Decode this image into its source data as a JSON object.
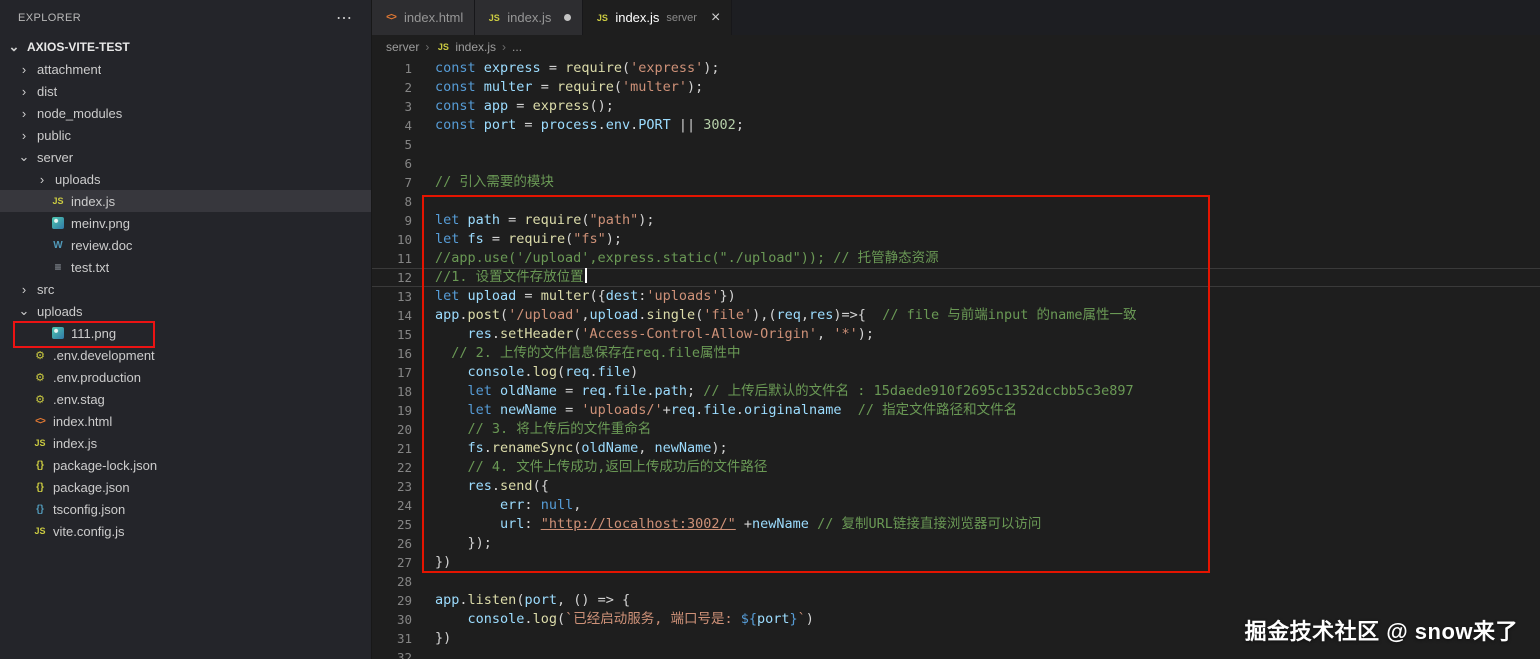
{
  "ui": {
    "dots": "⋯",
    "chev_open": "⌄",
    "chev_closed": "›",
    "crumb_sep": "›",
    "close": "×"
  },
  "icon_glyphs": {
    "js": "JS",
    "html": "<>",
    "json": "{}",
    "jsonblue": "{}",
    "env": "⚙",
    "doc": "W",
    "txt": "≡",
    "img": ""
  },
  "explorer": {
    "title": "EXPLORER",
    "root": "AXIOS-VITE-TEST",
    "items": [
      {
        "label": "attachment",
        "kind": "folder",
        "depth": 1
      },
      {
        "label": "dist",
        "kind": "folder",
        "depth": 1
      },
      {
        "label": "node_modules",
        "kind": "folder",
        "depth": 1
      },
      {
        "label": "public",
        "kind": "folder",
        "depth": 1
      },
      {
        "label": "server",
        "kind": "folder",
        "depth": 1,
        "expanded": true
      },
      {
        "label": "uploads",
        "kind": "folder",
        "depth": 2
      },
      {
        "label": "index.js",
        "kind": "file",
        "icon": "js",
        "depth": 2,
        "selected": true
      },
      {
        "label": "meinv.png",
        "kind": "file",
        "icon": "img",
        "depth": 2
      },
      {
        "label": "review.doc",
        "kind": "file",
        "icon": "doc",
        "depth": 2
      },
      {
        "label": "test.txt",
        "kind": "file",
        "icon": "txt",
        "depth": 2
      },
      {
        "label": "src",
        "kind": "folder",
        "depth": 1
      },
      {
        "label": "uploads",
        "kind": "folder",
        "depth": 1,
        "expanded": true
      },
      {
        "label": "111.png",
        "kind": "file",
        "icon": "img",
        "depth": 2,
        "highlight": true
      },
      {
        "label": ".env.development",
        "kind": "file",
        "icon": "env",
        "depth": 1
      },
      {
        "label": ".env.production",
        "kind": "file",
        "icon": "env",
        "depth": 1
      },
      {
        "label": ".env.stag",
        "kind": "file",
        "icon": "env",
        "depth": 1
      },
      {
        "label": "index.html",
        "kind": "file",
        "icon": "html",
        "depth": 1
      },
      {
        "label": "index.js",
        "kind": "file",
        "icon": "js",
        "depth": 1
      },
      {
        "label": "package-lock.json",
        "kind": "file",
        "icon": "json",
        "depth": 1
      },
      {
        "label": "package.json",
        "kind": "file",
        "icon": "json",
        "depth": 1
      },
      {
        "label": "tsconfig.json",
        "kind": "file",
        "icon": "jsonblue",
        "depth": 1
      },
      {
        "label": "vite.config.js",
        "kind": "file",
        "icon": "js",
        "depth": 1
      }
    ]
  },
  "tabs": [
    {
      "label": "index.html",
      "icon": "html",
      "active": false
    },
    {
      "label": "index.js",
      "icon": "js",
      "active": false,
      "modified": true
    },
    {
      "label": "index.js",
      "icon": "js",
      "hint": "server",
      "active": true,
      "closable": true
    }
  ],
  "breadcrumb": {
    "items": [
      {
        "label": "server"
      },
      {
        "label": "index.js",
        "icon": "js"
      },
      {
        "label": "..."
      }
    ]
  },
  "code": {
    "lines": [
      {
        "num": 1,
        "segs": [
          [
            "const ",
            "k"
          ],
          [
            "express",
            "v"
          ],
          [
            " = ",
            "p"
          ],
          [
            "require",
            "f"
          ],
          [
            "(",
            "p"
          ],
          [
            "'express'",
            "s"
          ],
          [
            ");",
            "p"
          ]
        ]
      },
      {
        "num": 2,
        "segs": [
          [
            "const ",
            "k"
          ],
          [
            "multer",
            "v"
          ],
          [
            " = ",
            "p"
          ],
          [
            "require",
            "f"
          ],
          [
            "(",
            "p"
          ],
          [
            "'multer'",
            "s"
          ],
          [
            ");",
            "p"
          ]
        ]
      },
      {
        "num": 3,
        "segs": [
          [
            "const ",
            "k"
          ],
          [
            "app",
            "v"
          ],
          [
            " = ",
            "p"
          ],
          [
            "express",
            "f"
          ],
          [
            "();",
            "p"
          ]
        ]
      },
      {
        "num": 4,
        "segs": [
          [
            "const ",
            "k"
          ],
          [
            "port",
            "v"
          ],
          [
            " = ",
            "p"
          ],
          [
            "process",
            "v"
          ],
          [
            ".",
            "p"
          ],
          [
            "env",
            "v"
          ],
          [
            ".",
            "p"
          ],
          [
            "PORT",
            "v"
          ],
          [
            " || ",
            "p"
          ],
          [
            "3002",
            "n"
          ],
          [
            ";",
            "p"
          ]
        ]
      },
      {
        "num": 5,
        "segs": []
      },
      {
        "num": 6,
        "segs": []
      },
      {
        "num": 7,
        "segs": [
          [
            "// 引入需要的模块",
            "c"
          ]
        ]
      },
      {
        "num": 8,
        "segs": []
      },
      {
        "num": 9,
        "segs": [
          [
            "let ",
            "k"
          ],
          [
            "path",
            "v"
          ],
          [
            " = ",
            "p"
          ],
          [
            "require",
            "f"
          ],
          [
            "(",
            "p"
          ],
          [
            "\"path\"",
            "s"
          ],
          [
            ");",
            "p"
          ]
        ]
      },
      {
        "num": 10,
        "segs": [
          [
            "let ",
            "k"
          ],
          [
            "fs",
            "v"
          ],
          [
            " = ",
            "p"
          ],
          [
            "require",
            "f"
          ],
          [
            "(",
            "p"
          ],
          [
            "\"fs\"",
            "s"
          ],
          [
            ");",
            "p"
          ]
        ]
      },
      {
        "num": 11,
        "segs": [
          [
            "//app.use('/upload',express.static(\"./upload\")); // 托管静态资源",
            "c"
          ]
        ]
      },
      {
        "num": 12,
        "current": true,
        "cursor": true,
        "segs": [
          [
            "//1. 设置文件存放位置",
            "c"
          ]
        ]
      },
      {
        "num": 13,
        "segs": [
          [
            "let ",
            "k"
          ],
          [
            "upload",
            "v"
          ],
          [
            " = ",
            "p"
          ],
          [
            "multer",
            "f"
          ],
          [
            "({",
            "p"
          ],
          [
            "dest",
            "v"
          ],
          [
            ":",
            "p"
          ],
          [
            "'uploads'",
            "s"
          ],
          [
            "})",
            "p"
          ]
        ]
      },
      {
        "num": 14,
        "segs": [
          [
            "app",
            "v"
          ],
          [
            ".",
            "p"
          ],
          [
            "post",
            "f"
          ],
          [
            "(",
            "p"
          ],
          [
            "'/upload'",
            "s"
          ],
          [
            ",",
            "p"
          ],
          [
            "upload",
            "v"
          ],
          [
            ".",
            "p"
          ],
          [
            "single",
            "f"
          ],
          [
            "(",
            "p"
          ],
          [
            "'file'",
            "s"
          ],
          [
            "),(",
            "p"
          ],
          [
            "req",
            "v"
          ],
          [
            ",",
            "p"
          ],
          [
            "res",
            "v"
          ],
          [
            ")=>{",
            "p"
          ],
          [
            "  // file 与前端input 的name属性一致",
            "c"
          ]
        ]
      },
      {
        "num": 15,
        "segs": [
          [
            "    ",
            "p"
          ],
          [
            "res",
            "v"
          ],
          [
            ".",
            "p"
          ],
          [
            "setHeader",
            "f"
          ],
          [
            "(",
            "p"
          ],
          [
            "'Access-Control-Allow-Origin'",
            "s"
          ],
          [
            ", ",
            "p"
          ],
          [
            "'*'",
            "s"
          ],
          [
            ");",
            "p"
          ]
        ]
      },
      {
        "num": 16,
        "segs": [
          [
            "  // 2. 上传的文件信息保存在req.file属性中",
            "c"
          ]
        ]
      },
      {
        "num": 17,
        "segs": [
          [
            "    ",
            "p"
          ],
          [
            "console",
            "v"
          ],
          [
            ".",
            "p"
          ],
          [
            "log",
            "f"
          ],
          [
            "(",
            "p"
          ],
          [
            "req",
            "v"
          ],
          [
            ".",
            "p"
          ],
          [
            "file",
            "v"
          ],
          [
            ")",
            "p"
          ]
        ]
      },
      {
        "num": 18,
        "segs": [
          [
            "    ",
            "p"
          ],
          [
            "let ",
            "k"
          ],
          [
            "oldName",
            "v"
          ],
          [
            " = ",
            "p"
          ],
          [
            "req",
            "v"
          ],
          [
            ".",
            "p"
          ],
          [
            "file",
            "v"
          ],
          [
            ".",
            "p"
          ],
          [
            "path",
            "v"
          ],
          [
            "; ",
            "p"
          ],
          [
            "// 上传后默认的文件名 : 15daede910f2695c1352dccbb5c3e897",
            "c"
          ]
        ]
      },
      {
        "num": 19,
        "segs": [
          [
            "    ",
            "p"
          ],
          [
            "let ",
            "k"
          ],
          [
            "newName",
            "v"
          ],
          [
            " = ",
            "p"
          ],
          [
            "'uploads/'",
            "s"
          ],
          [
            "+",
            "p"
          ],
          [
            "req",
            "v"
          ],
          [
            ".",
            "p"
          ],
          [
            "file",
            "v"
          ],
          [
            ".",
            "p"
          ],
          [
            "originalname",
            "v"
          ],
          [
            "  ",
            "p"
          ],
          [
            "// 指定文件路径和文件名",
            "c"
          ]
        ]
      },
      {
        "num": 20,
        "segs": [
          [
            "    // 3. 将上传后的文件重命名",
            "c"
          ]
        ]
      },
      {
        "num": 21,
        "segs": [
          [
            "    ",
            "p"
          ],
          [
            "fs",
            "v"
          ],
          [
            ".",
            "p"
          ],
          [
            "renameSync",
            "f"
          ],
          [
            "(",
            "p"
          ],
          [
            "oldName",
            "v"
          ],
          [
            ", ",
            "p"
          ],
          [
            "newName",
            "v"
          ],
          [
            ");",
            "p"
          ]
        ]
      },
      {
        "num": 22,
        "segs": [
          [
            "    // 4. 文件上传成功,返回上传成功后的文件路径",
            "c"
          ]
        ]
      },
      {
        "num": 23,
        "segs": [
          [
            "    ",
            "p"
          ],
          [
            "res",
            "v"
          ],
          [
            ".",
            "p"
          ],
          [
            "send",
            "f"
          ],
          [
            "({",
            "p"
          ]
        ]
      },
      {
        "num": 24,
        "segs": [
          [
            "        ",
            "p"
          ],
          [
            "err",
            "v"
          ],
          [
            ": ",
            "p"
          ],
          [
            "null",
            "k"
          ],
          [
            ",",
            "p"
          ]
        ]
      },
      {
        "num": 25,
        "segs": [
          [
            "        ",
            "p"
          ],
          [
            "url",
            "v"
          ],
          [
            ": ",
            "p"
          ],
          [
            "\"http://localhost:3002/\"",
            "su"
          ],
          [
            " +",
            "p"
          ],
          [
            "newName",
            "v"
          ],
          [
            " ",
            "p"
          ],
          [
            "// 复制URL链接直接浏览器可以访问",
            "c"
          ]
        ]
      },
      {
        "num": 26,
        "segs": [
          [
            "    });",
            "p"
          ]
        ]
      },
      {
        "num": 27,
        "segs": [
          [
            "})",
            "p"
          ]
        ]
      },
      {
        "num": 28,
        "segs": []
      },
      {
        "num": 29,
        "segs": [
          [
            "app",
            "v"
          ],
          [
            ".",
            "p"
          ],
          [
            "listen",
            "f"
          ],
          [
            "(",
            "p"
          ],
          [
            "port",
            "v"
          ],
          [
            ", ",
            "p"
          ],
          [
            "() => {",
            "p"
          ]
        ]
      },
      {
        "num": 30,
        "segs": [
          [
            "    ",
            "p"
          ],
          [
            "console",
            "v"
          ],
          [
            ".",
            "p"
          ],
          [
            "log",
            "f"
          ],
          [
            "(",
            "p"
          ],
          [
            "`已经启动服务, 端口号是: ",
            "s"
          ],
          [
            "${",
            "k"
          ],
          [
            "port",
            "v"
          ],
          [
            "}",
            "k"
          ],
          [
            "`",
            "s"
          ],
          [
            ")",
            "p"
          ]
        ]
      },
      {
        "num": 31,
        "segs": [
          [
            "})",
            "p"
          ]
        ]
      },
      {
        "num": 32,
        "segs": []
      }
    ]
  },
  "watermark": "掘金技术社区 @ snow来了"
}
